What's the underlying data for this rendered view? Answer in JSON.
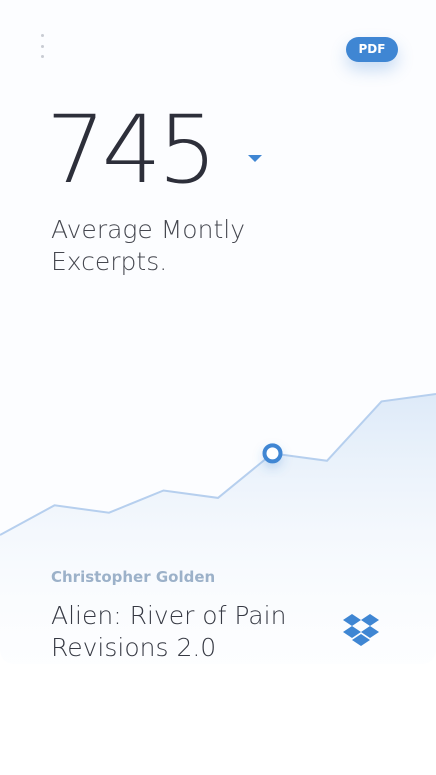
{
  "header": {
    "export_label": "PDF"
  },
  "metric": {
    "value": "745",
    "label": "Average Montly Excerpts."
  },
  "chart_data": {
    "type": "area",
    "x": [
      0,
      1,
      2,
      3,
      4,
      5,
      6,
      7,
      8
    ],
    "y": [
      4,
      8,
      7,
      10,
      9,
      15,
      14,
      22,
      23
    ],
    "highlight_index": 5,
    "colors": {
      "line": "#b6cfee",
      "fill": "#e3eefb",
      "marker": "#3f86d3"
    }
  },
  "book": {
    "author": "Christopher Golden",
    "title": "Alien: River of Pain Revisions 2.0"
  },
  "icons": {
    "menu": "more-vertical-icon",
    "dropdown": "caret-down-icon",
    "storage": "dropbox-icon"
  }
}
